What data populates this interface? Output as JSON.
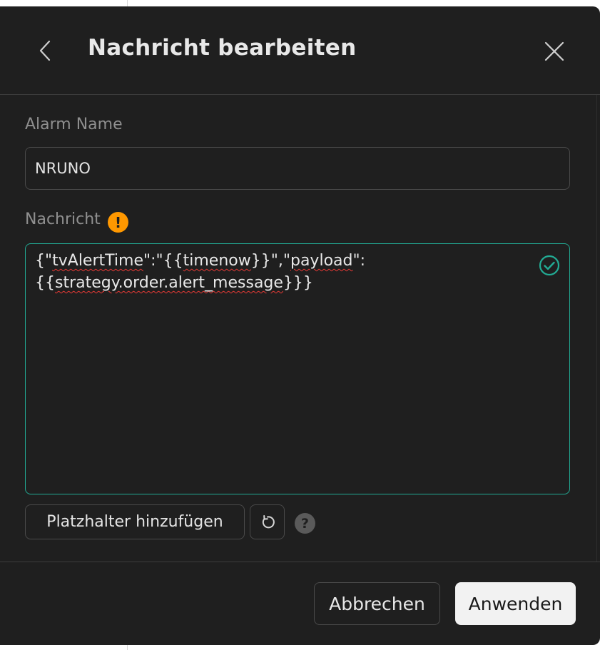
{
  "dialog": {
    "title": "Nachricht bearbeiten",
    "back_icon": "chevron-left-icon",
    "close_icon": "close-icon"
  },
  "alarm_name": {
    "label": "Alarm Name",
    "value": "NRUNO"
  },
  "message": {
    "label": "Nachricht",
    "warning_icon": "warning-icon",
    "text_parts": [
      "{\"",
      "tvAlertTime",
      "\":\"{{",
      "timenow",
      "}}\",\"",
      "payload",
      "\":\n{{",
      "strategy.order.alert_message",
      "}}}"
    ],
    "valid_icon": "check-circle-icon",
    "accent_color": "#22ab94"
  },
  "tools": {
    "add_placeholder_label": "Platzhalter hinzufügen",
    "reset_icon": "reset-icon",
    "help_icon": "help-icon",
    "help_glyph": "?"
  },
  "footer": {
    "cancel_label": "Abbrechen",
    "apply_label": "Anwenden"
  },
  "colors": {
    "dialog_bg": "#1f1f1f",
    "warning": "#ff9800",
    "spell_error": "#e53935"
  }
}
